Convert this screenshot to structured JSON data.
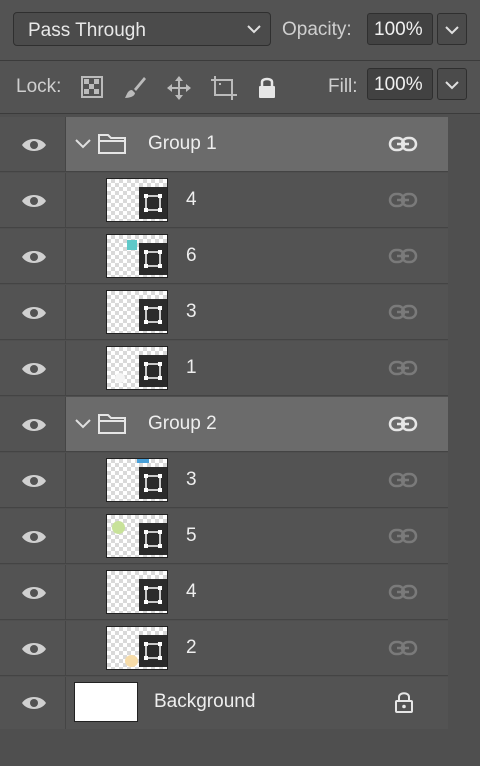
{
  "blend_mode": {
    "value": "Pass Through"
  },
  "opacity": {
    "label": "Opacity:",
    "value": "100%"
  },
  "lock": {
    "label": "Lock:",
    "icons": [
      "lock-transparent-pixels-icon",
      "lock-image-pixels-icon",
      "lock-position-icon",
      "lock-artboard-icon",
      "lock-all-icon"
    ]
  },
  "fill": {
    "label": "Fill:",
    "value": "100%"
  },
  "layers": [
    {
      "type": "group",
      "name": "Group 1"
    },
    {
      "type": "layer",
      "name": "4",
      "swatch": null
    },
    {
      "type": "layer",
      "name": "6",
      "swatch": "#5fc9c9"
    },
    {
      "type": "layer",
      "name": "3",
      "swatch": null
    },
    {
      "type": "layer",
      "name": "1",
      "swatch": "#f5f5f5"
    },
    {
      "type": "group",
      "name": "Group 2"
    },
    {
      "type": "layer",
      "name": "3",
      "swatch": "#4aa0d8"
    },
    {
      "type": "layer",
      "name": "5",
      "swatch": "#c8e29a"
    },
    {
      "type": "layer",
      "name": "4",
      "swatch": null
    },
    {
      "type": "layer",
      "name": "2",
      "swatch": "#f7dca8"
    },
    {
      "type": "background",
      "name": "Background"
    }
  ],
  "colors": {
    "panel": "#535353",
    "group_row": "#6b6b6b",
    "text": "#eeeeee"
  }
}
